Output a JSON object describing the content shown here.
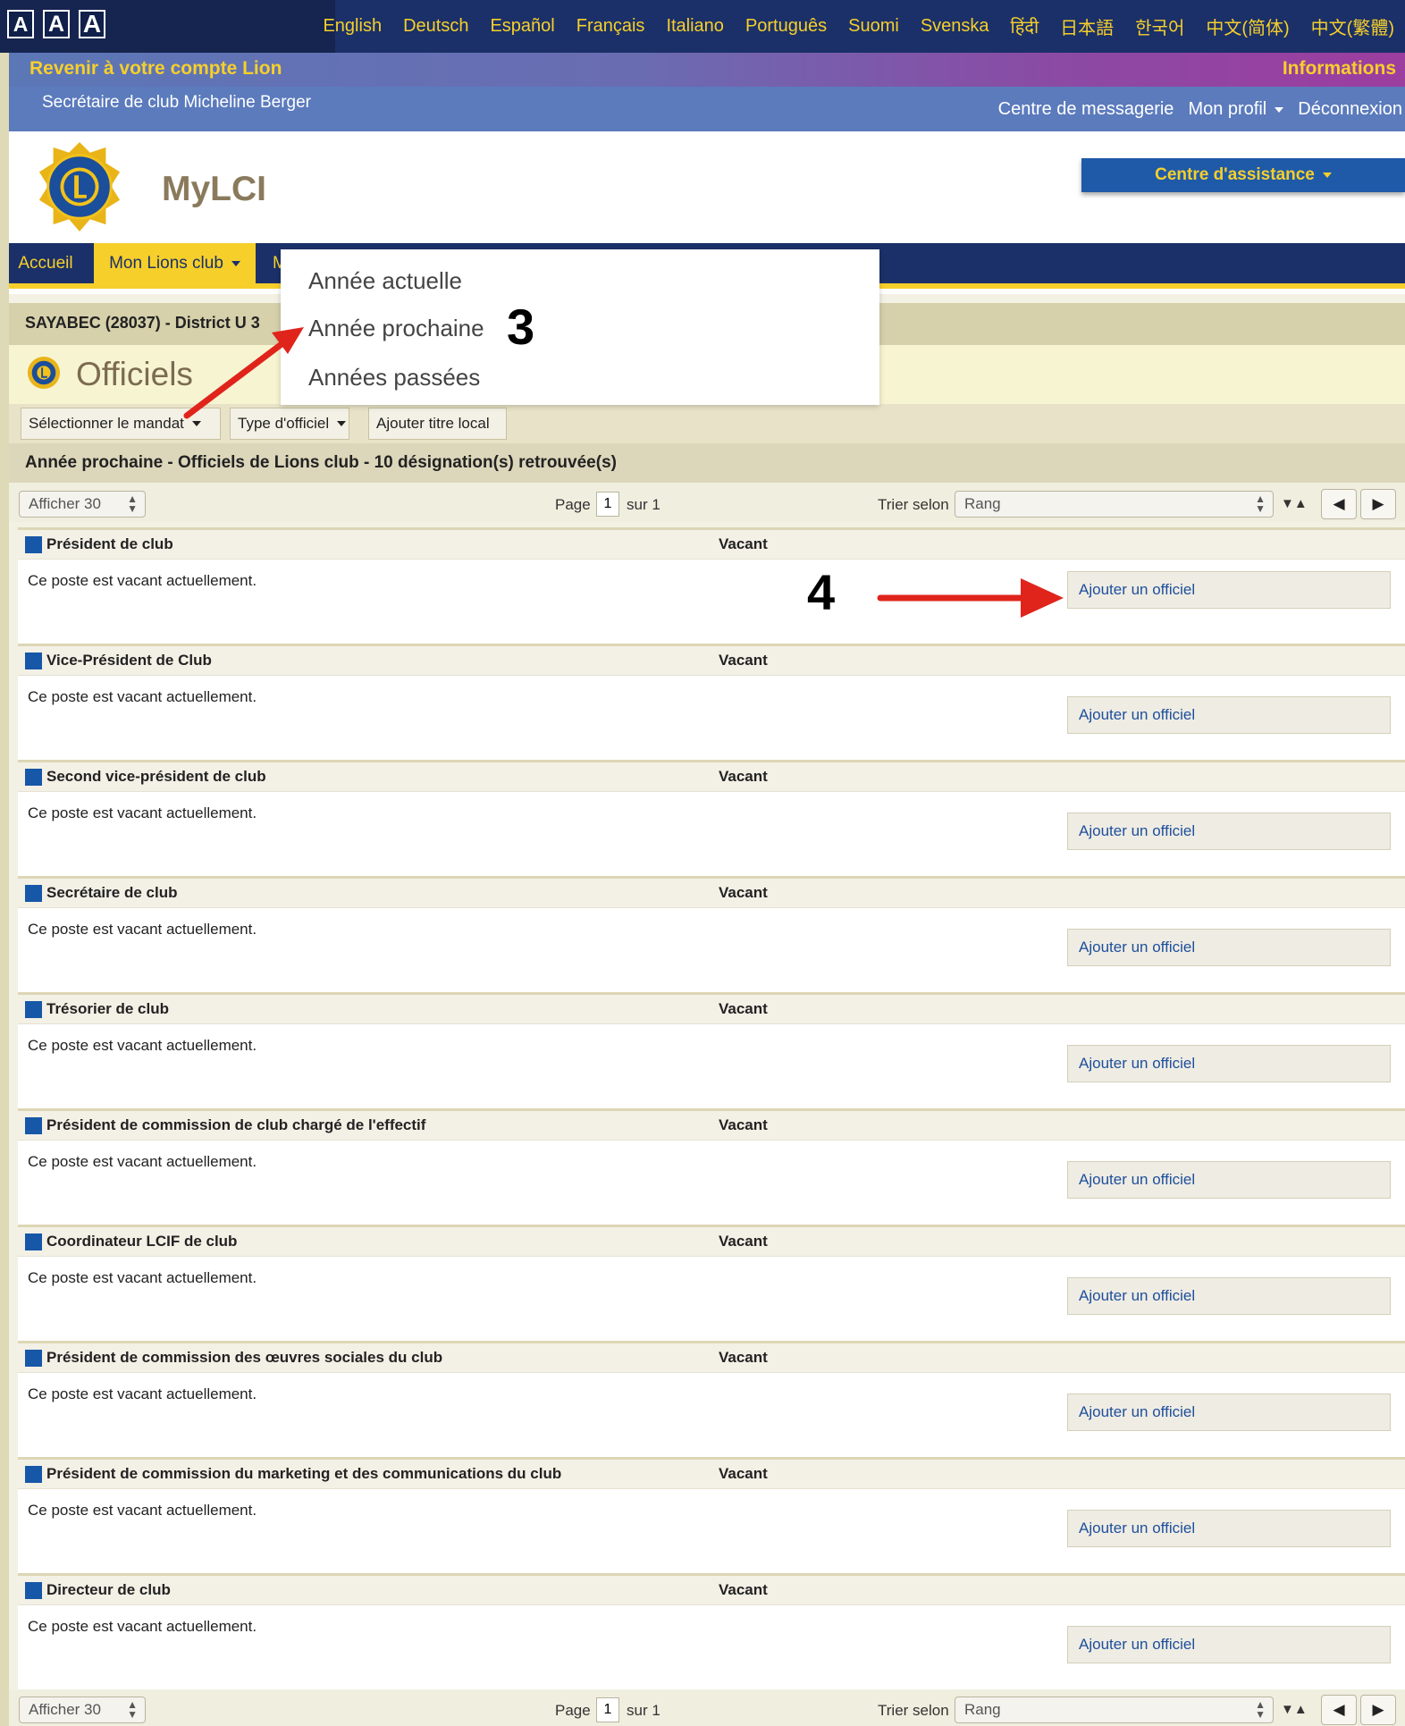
{
  "topbar": {
    "font_sizes": [
      "A",
      "A",
      "A"
    ],
    "languages": [
      "English",
      "Deutsch",
      "Español",
      "Français",
      "Italiano",
      "Português",
      "Suomi",
      "Svenska",
      "हिंदी",
      "日本語",
      "한국어",
      "中文(简体)",
      "中文(繁體)"
    ]
  },
  "band": {
    "back_link": "Revenir à votre compte Lion",
    "info_link": "Informations"
  },
  "userbar": {
    "user": "Secrétaire de club Micheline Berger",
    "messages": "Centre de messagerie",
    "profile": "Mon profil",
    "logout": "Déconnexion"
  },
  "header": {
    "brand": "MyLCI",
    "assist": "Centre d'assistance"
  },
  "nav": {
    "home": "Accueil",
    "my_club": "Mon Lions club",
    "partial": "M"
  },
  "club": {
    "name": "SAYABEC (28037) - District U 3"
  },
  "page": {
    "title": "Officiels"
  },
  "toolbar": {
    "select_term": "Sélectionner le mandat",
    "officer_type": "Type d'officiel",
    "add_local": "Ajouter titre local"
  },
  "results": {
    "summary": "Année prochaine - Officiels de Lions club - 10 désignation(s) retrouvée(s)"
  },
  "pager": {
    "show": "Afficher 30",
    "page_label": "Page",
    "page_num": "1",
    "of_label": "sur 1",
    "sort_label": "Trier selon",
    "sort_value": "Rang",
    "sort_icon": "▼▲",
    "prev": "◀",
    "next": "▶"
  },
  "dropdown": {
    "items": [
      "Année actuelle",
      "Année prochaine",
      "Années passées"
    ]
  },
  "annotations": {
    "step3": "3",
    "step4": "4"
  },
  "officers": [
    {
      "title": "Président de club",
      "status": "Vacant",
      "message": "Ce poste est vacant actuellement.",
      "button": "Ajouter un officiel"
    },
    {
      "title": "Vice-Président de Club",
      "status": "Vacant",
      "message": "Ce poste est vacant actuellement.",
      "button": "Ajouter un officiel"
    },
    {
      "title": "Second vice-président de club",
      "status": "Vacant",
      "message": "Ce poste est vacant actuellement.",
      "button": "Ajouter un officiel"
    },
    {
      "title": "Secrétaire de club",
      "status": "Vacant",
      "message": "Ce poste est vacant actuellement.",
      "button": "Ajouter un officiel"
    },
    {
      "title": "Trésorier de club",
      "status": "Vacant",
      "message": "Ce poste est vacant actuellement.",
      "button": "Ajouter un officiel"
    },
    {
      "title": "Président de commission de club chargé de l'effectif",
      "status": "Vacant",
      "message": "Ce poste est vacant actuellement.",
      "button": "Ajouter un officiel"
    },
    {
      "title": "Coordinateur LCIF de club",
      "status": "Vacant",
      "message": "Ce poste est vacant actuellement.",
      "button": "Ajouter un officiel"
    },
    {
      "title": "Président de commission des œuvres sociales du club",
      "status": "Vacant",
      "message": "Ce poste est vacant actuellement.",
      "button": "Ajouter un officiel"
    },
    {
      "title": "Président de commission du marketing et des communications du club",
      "status": "Vacant",
      "message": "Ce poste est vacant actuellement.",
      "button": "Ajouter un officiel"
    },
    {
      "title": "Directeur de club",
      "status": "Vacant",
      "message": "Ce poste est vacant actuellement.",
      "button": "Ajouter un officiel"
    }
  ],
  "colors": {
    "navy": "#1b3068",
    "gold": "#f6cf2b",
    "blue": "#1f5aa8",
    "annotation_red": "#e0241b"
  }
}
